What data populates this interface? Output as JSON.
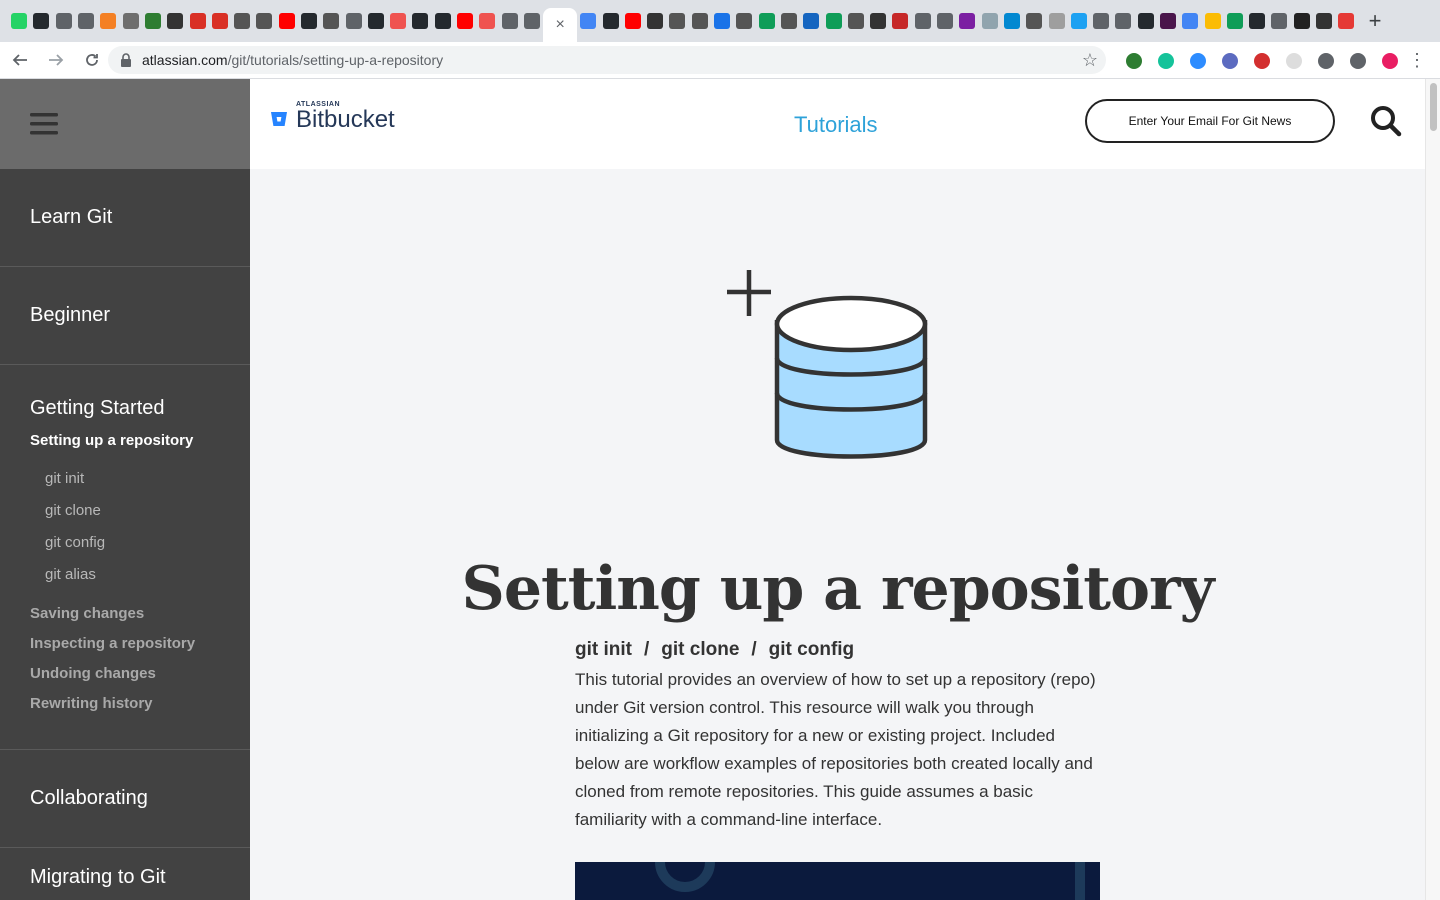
{
  "browser": {
    "active_tab_close": "×",
    "new_tab": "+",
    "url_host": "atlassian.com",
    "url_path": "/git/tutorials/setting-up-a-repository",
    "favicons": [
      "#25d366",
      "#24292e",
      "#5f6368",
      "#5f6368",
      "#f48024",
      "#6e6e6e",
      "#2e7d32",
      "#333333",
      "#d93025",
      "#d93025",
      "#555555",
      "#555555",
      "#ff0000",
      "#24292e",
      "#555555",
      "#5f6368",
      "#24292e",
      "#ef5350",
      "#24292e",
      "#24292e",
      "#ff0000",
      "#ef5350",
      "#5f6368",
      "#5f6368"
    ],
    "favicons_right": [
      "#4285f4",
      "#24292e",
      "#ff0000",
      "#333333",
      "#555555",
      "#555555",
      "#1a73e8",
      "#555555",
      "#0f9d58",
      "#555555",
      "#1565c0",
      "#0f9d58",
      "#555555",
      "#333333",
      "#c62828",
      "#5f6368",
      "#5f6368",
      "#7b1fa2",
      "#90a4ae",
      "#0288d1",
      "#555555",
      "#9e9e9e",
      "#1da1f2",
      "#5f6368",
      "#5f6368",
      "#24292e",
      "#4a154b",
      "#4285f4",
      "#fbbc04",
      "#0f9d58",
      "#24292e",
      "#5f6368",
      "#212121",
      "#333333",
      "#e53935"
    ],
    "extensions": [
      "#2e7d32",
      "#15c39a",
      "#2d8cff",
      "#5c6bc0",
      "#d32f2f",
      "#dddddd",
      "#5f6368",
      "#5f6368",
      "#e91e63"
    ]
  },
  "sidebar": {
    "sections_top": [
      "Learn Git",
      "Beginner"
    ],
    "current_group": "Getting Started",
    "active_item": "Setting up a repository",
    "sub_items": [
      "git init",
      "git clone",
      "git config",
      "git alias"
    ],
    "siblings": [
      "Saving changes",
      "Inspecting a repository",
      "Undoing changes",
      "Rewriting history"
    ],
    "sections_bottom": [
      "Collaborating"
    ],
    "partial_next": "Migrating to Git"
  },
  "header": {
    "brand_small": "ATLASSIAN",
    "brand": "Bitbucket",
    "nav_link": "Tutorials",
    "email_cta": "Enter Your Email For Git News"
  },
  "main": {
    "title": "Setting up a repository",
    "crumbs": [
      "git init",
      "git clone",
      "git config"
    ],
    "crumb_separator": "/",
    "intro": "This tutorial provides an overview of how to set up a repository (repo) under Git version control. This resource will walk you through initializing a Git repository for a new or existing project. Included below are workflow examples of repositories both created locally and cloned from remote repositories. This guide assumes a basic familiarity with a command-line interface."
  },
  "colors": {
    "sidebar_bg": "#424242",
    "accent_link": "#2ea2d9",
    "db_fill": "#a8dcff",
    "ink": "#333333"
  }
}
